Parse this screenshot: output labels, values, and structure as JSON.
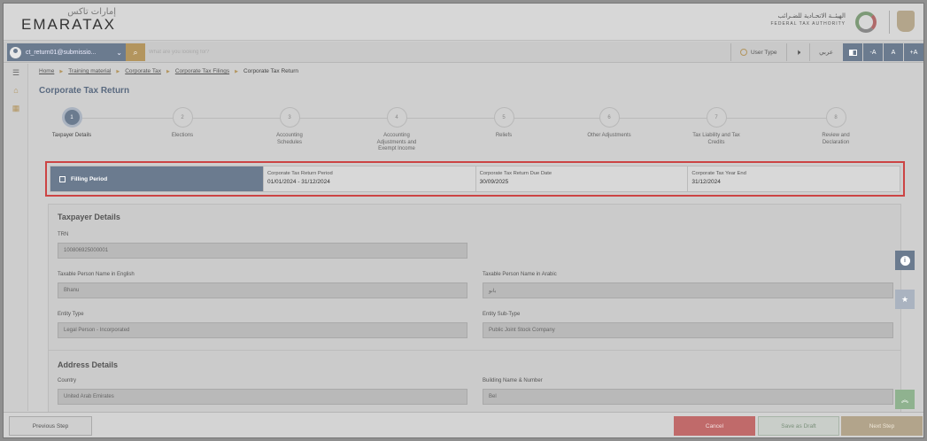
{
  "header": {
    "logo_ar": "إمارات تاكس",
    "logo_en": "EMARATAX",
    "fta_ar": "الهيئــة الاتحـادية للضـرائب",
    "fta_en": "FEDERAL TAX AUTHORITY"
  },
  "searchbar": {
    "user": "ct_return01@submissio...",
    "placeholder": "What are you looking for?",
    "user_type": "User Type",
    "lang": "عربي",
    "font_minus": "-A",
    "font_normal": "A",
    "font_plus": "+A"
  },
  "breadcrumb": {
    "items": [
      "Home",
      "Training material",
      "Corporate Tax",
      "Corporate Tax Filings"
    ],
    "current": "Corporate Tax Return"
  },
  "page_title": "Corporate Tax Return",
  "steps": [
    {
      "num": "1",
      "label": "Taxpayer Details"
    },
    {
      "num": "2",
      "label": "Elections"
    },
    {
      "num": "3",
      "label": "Accounting Schedules"
    },
    {
      "num": "4",
      "label": "Accounting Adjustments and Exempt Income"
    },
    {
      "num": "5",
      "label": "Reliefs"
    },
    {
      "num": "6",
      "label": "Other Adjustments"
    },
    {
      "num": "7",
      "label": "Tax Liability and Tax Credits"
    },
    {
      "num": "8",
      "label": "Review and Declaration"
    }
  ],
  "filing": {
    "head": "Filling Period",
    "period_label": "Corporate Tax Return Period",
    "period_value": "01/01/2024  -  31/12/2024",
    "due_label": "Corporate Tax Return Due Date",
    "due_value": "30/09/2025",
    "yearend_label": "Corporate Tax Year End",
    "yearend_value": "31/12/2024"
  },
  "taxpayer": {
    "section": "Taxpayer Details",
    "trn_label": "TRN",
    "trn_value": "100806925000001",
    "name_en_label": "Taxable Person Name in English",
    "name_en_value": "Bhanu",
    "name_ar_label": "Taxable Person Name in Arabic",
    "name_ar_value": "بانو",
    "entity_label": "Entity Type",
    "entity_value": "Legal Person - Incorporated",
    "subtype_label": "Entity Sub-Type",
    "subtype_value": "Public Joint Stock Company"
  },
  "address": {
    "section": "Address Details",
    "country_label": "Country",
    "country_value": "United Arab Emirates",
    "building_label": "Building Name & Number",
    "building_value": "Bel"
  },
  "footer": {
    "prev": "Previous Step",
    "cancel": "Cancel",
    "draft": "Save as Draft",
    "next": "Next Step"
  }
}
